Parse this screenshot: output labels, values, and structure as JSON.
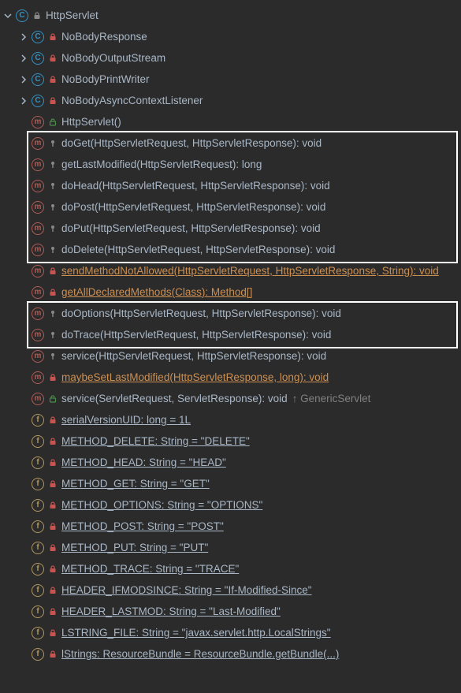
{
  "root": {
    "label": "HttpServlet"
  },
  "rows": [
    {
      "kind": "class",
      "label": "NoBodyResponse",
      "vis": "private",
      "expand": "closed",
      "indent": 1
    },
    {
      "kind": "class",
      "label": "NoBodyOutputStream",
      "vis": "private",
      "expand": "closed",
      "indent": 1
    },
    {
      "kind": "class",
      "label": "NoBodyPrintWriter",
      "vis": "private",
      "expand": "closed",
      "indent": 1
    },
    {
      "kind": "class",
      "label": "NoBodyAsyncContextListener",
      "vis": "private",
      "expand": "closed",
      "indent": 1
    },
    {
      "kind": "method",
      "label": "HttpServlet()",
      "vis": "public",
      "indent": 1
    },
    {
      "kind": "method",
      "label": "doGet(HttpServletRequest, HttpServletResponse): void",
      "vis": "protected",
      "indent": 1,
      "hl": 1
    },
    {
      "kind": "method",
      "label": "getLastModified(HttpServletRequest): long",
      "vis": "protected",
      "indent": 1,
      "hl": 1
    },
    {
      "kind": "method",
      "label": "doHead(HttpServletRequest, HttpServletResponse): void",
      "vis": "protected",
      "indent": 1,
      "hl": 1
    },
    {
      "kind": "method",
      "label": "doPost(HttpServletRequest, HttpServletResponse): void",
      "vis": "protected",
      "indent": 1,
      "hl": 1
    },
    {
      "kind": "method",
      "label": "doPut(HttpServletRequest, HttpServletResponse): void",
      "vis": "protected",
      "indent": 1,
      "hl": 1
    },
    {
      "kind": "method",
      "label": "doDelete(HttpServletRequest, HttpServletResponse): void",
      "vis": "protected",
      "indent": 1,
      "hl": 1
    },
    {
      "kind": "method",
      "label": "sendMethodNotAllowed(HttpServletRequest, HttpServletResponse, String): void",
      "vis": "private",
      "indent": 1,
      "orange": true
    },
    {
      "kind": "method",
      "label": "getAllDeclaredMethods(Class<?>): Method[]",
      "vis": "private",
      "indent": 1,
      "orange": true
    },
    {
      "kind": "method",
      "label": "doOptions(HttpServletRequest, HttpServletResponse): void",
      "vis": "protected",
      "indent": 1,
      "hl": 2
    },
    {
      "kind": "method",
      "label": "doTrace(HttpServletRequest, HttpServletResponse): void",
      "vis": "protected",
      "indent": 1,
      "hl": 2
    },
    {
      "kind": "method",
      "label": "service(HttpServletRequest, HttpServletResponse): void",
      "vis": "protected",
      "indent": 1
    },
    {
      "kind": "method",
      "label": "maybeSetLastModified(HttpServletResponse, long): void",
      "vis": "private",
      "indent": 1,
      "orange": true
    },
    {
      "kind": "method",
      "label": "service(ServletRequest, ServletResponse): void",
      "vis": "public",
      "indent": 1,
      "inherit": "↑ GenericServlet"
    },
    {
      "kind": "field",
      "label": "serialVersionUID: long = 1L",
      "vis": "private",
      "indent": 1,
      "underline": true
    },
    {
      "kind": "field",
      "label": "METHOD_DELETE: String = \"DELETE\"",
      "vis": "private",
      "indent": 1,
      "underline": true
    },
    {
      "kind": "field",
      "label": "METHOD_HEAD: String = \"HEAD\"",
      "vis": "private",
      "indent": 1,
      "underline": true
    },
    {
      "kind": "field",
      "label": "METHOD_GET: String = \"GET\"",
      "vis": "private",
      "indent": 1,
      "underline": true
    },
    {
      "kind": "field",
      "label": "METHOD_OPTIONS: String = \"OPTIONS\"",
      "vis": "private",
      "indent": 1,
      "underline": true
    },
    {
      "kind": "field",
      "label": "METHOD_POST: String = \"POST\"",
      "vis": "private",
      "indent": 1,
      "underline": true
    },
    {
      "kind": "field",
      "label": "METHOD_PUT: String = \"PUT\"",
      "vis": "private",
      "indent": 1,
      "underline": true
    },
    {
      "kind": "field",
      "label": "METHOD_TRACE: String = \"TRACE\"",
      "vis": "private",
      "indent": 1,
      "underline": true
    },
    {
      "kind": "field",
      "label": "HEADER_IFMODSINCE: String = \"If-Modified-Since\"",
      "vis": "private",
      "indent": 1,
      "underline": true
    },
    {
      "kind": "field",
      "label": "HEADER_LASTMOD: String = \"Last-Modified\"",
      "vis": "private",
      "indent": 1,
      "underline": true
    },
    {
      "kind": "field",
      "label": "LSTRING_FILE: String = \"javax.servlet.http.LocalStrings\"",
      "vis": "private",
      "indent": 1,
      "underline": true
    },
    {
      "kind": "field",
      "label": "lStrings: ResourceBundle = ResourceBundle.getBundle(...)",
      "vis": "private",
      "indent": 1,
      "underline": true
    }
  ]
}
